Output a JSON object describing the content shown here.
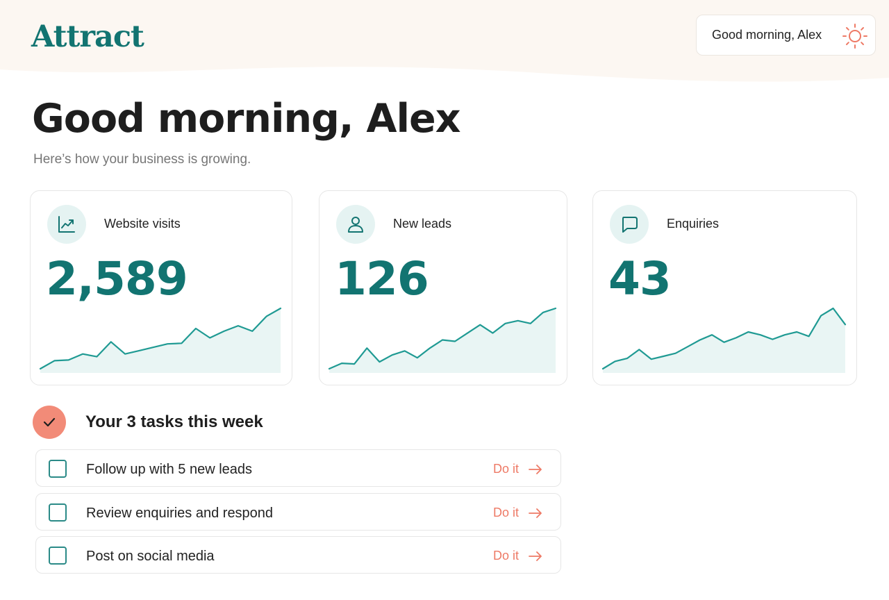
{
  "app": {
    "logo": "Attract"
  },
  "header": {
    "greeting_pill": "Good morning, Alex",
    "sun_icon": "sun-icon"
  },
  "main": {
    "headline": "Good morning, Alex",
    "subhead": "Here’s how your business is growing."
  },
  "cards": [
    {
      "label": "Website visits",
      "value": "2,589",
      "icon": "trending-up-icon",
      "trend": [
        0,
        12,
        13,
        22,
        18,
        40,
        22,
        27,
        32,
        37,
        38,
        60,
        46,
        56,
        64,
        56,
        78,
        90
      ]
    },
    {
      "label": "New leads",
      "value": "126",
      "icon": "user-icon",
      "trend": [
        0,
        8,
        7,
        30,
        10,
        20,
        26,
        16,
        30,
        42,
        40,
        52,
        64,
        52,
        66,
        70,
        66,
        82,
        88
      ]
    },
    {
      "label": "Enquiries",
      "value": "43",
      "icon": "chat-bubble-icon",
      "trend": [
        0,
        10,
        14,
        26,
        13,
        17,
        21,
        30,
        39,
        46,
        36,
        42,
        50,
        46,
        40,
        46,
        50,
        44,
        72,
        82,
        60
      ]
    }
  ],
  "tasks": {
    "title": "Your 3 tasks this week",
    "badge_icon": "checkmark-icon",
    "action_label": "Do it",
    "items": [
      {
        "text": "Follow up with 5 new leads"
      },
      {
        "text": "Review enquiries and respond"
      },
      {
        "text": "Post on social media"
      }
    ]
  },
  "colors": {
    "brand": "#127471",
    "spark_line": "#1f9a93",
    "spark_fill": "#e9f5f4",
    "accent": "#ee7a66",
    "header_bg": "#fcf7f2"
  }
}
